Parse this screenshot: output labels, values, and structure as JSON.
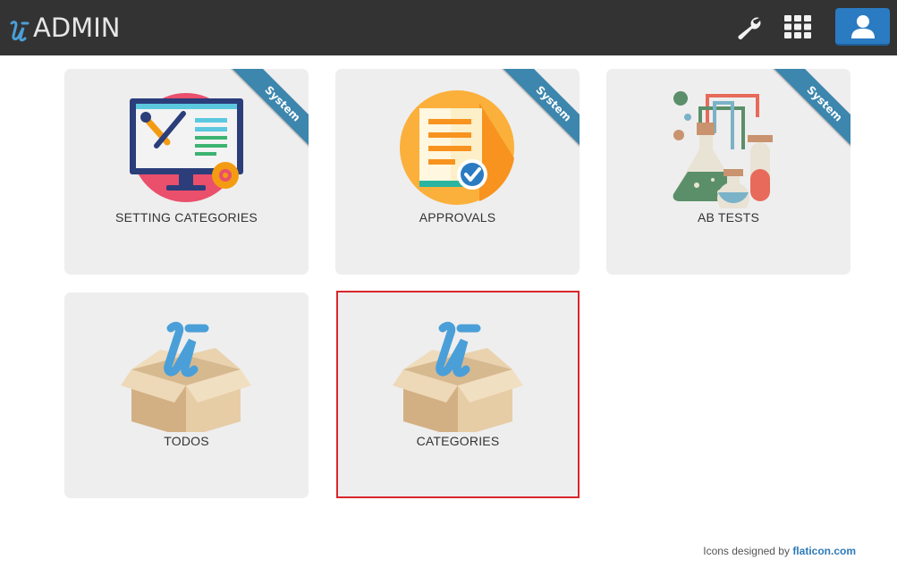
{
  "header": {
    "brand_text": "ADMIN",
    "logo_icon": "u-logo-icon",
    "actions": [
      {
        "name": "settings",
        "icon": "wrench-icon"
      },
      {
        "name": "apps",
        "icon": "grid-icon"
      },
      {
        "name": "user",
        "icon": "user-icon"
      }
    ]
  },
  "cards": [
    {
      "label": "SETTING CATEGORIES",
      "ribbon": "System",
      "icon": "monitor-tools-icon"
    },
    {
      "label": "APPROVALS",
      "ribbon": "System",
      "icon": "document-check-icon"
    },
    {
      "label": "AB TESTS",
      "ribbon": "System",
      "icon": "lab-flasks-icon"
    },
    {
      "label": "TODOS",
      "icon": "box-icon"
    },
    {
      "label": "CATEGORIES",
      "icon": "box-icon",
      "highlighted": true
    }
  ],
  "footer": {
    "prefix": "Icons designed by",
    "link": "flaticon.com"
  },
  "colors": {
    "navbar": "#333333",
    "user_button": "#2a7bc2",
    "card_bg": "#eeeeee",
    "ribbon": "#3d86ad",
    "highlight_border": "#d9262c",
    "link": "#2e7ab8"
  }
}
